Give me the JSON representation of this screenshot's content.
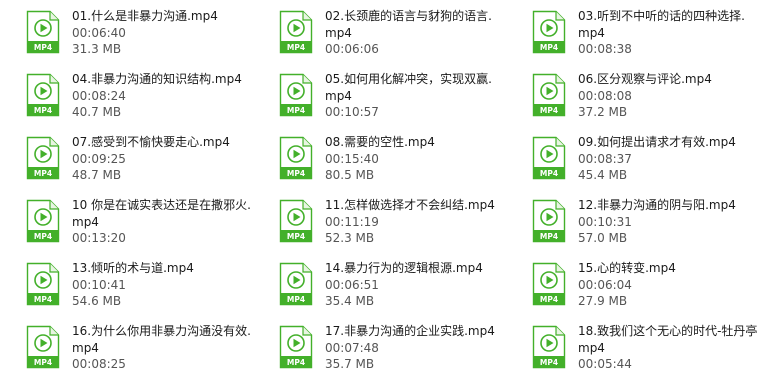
{
  "icon": {
    "label": "MP4",
    "name": "mp4-file-icon",
    "accent": "#43b02a"
  },
  "files": [
    {
      "lines": [
        "01.什么是非暴力沟通.mp4",
        "00:06:40",
        "31.3 MB"
      ]
    },
    {
      "lines": [
        "02.长颈鹿的语言与豺狗的语言.",
        "mp4",
        "00:06:06"
      ]
    },
    {
      "lines": [
        "03.听到不中听的话的四种选择.",
        "mp4",
        "00:08:38"
      ]
    },
    {
      "lines": [
        "04.非暴力沟通的知识结构.mp4",
        "00:08:24",
        "40.7 MB"
      ]
    },
    {
      "lines": [
        "05.如何用化解冲突，实现双赢.",
        "mp4",
        "00:10:57"
      ]
    },
    {
      "lines": [
        "06.区分观察与评论.mp4",
        "00:08:08",
        "37.2 MB"
      ]
    },
    {
      "lines": [
        "07.感受到不愉快要走心.mp4",
        "00:09:25",
        "48.7 MB"
      ]
    },
    {
      "lines": [
        "08.需要的空性.mp4",
        "00:15:40",
        "80.5 MB"
      ]
    },
    {
      "lines": [
        "09.如何提出请求才有效.mp4",
        "00:08:37",
        "45.4 MB"
      ]
    },
    {
      "lines": [
        "10 你是在诚实表达还是在撒邪火.",
        "mp4",
        "00:13:20"
      ]
    },
    {
      "lines": [
        "11.怎样做选择才不会纠结.mp4",
        "00:11:19",
        "52.3 MB"
      ]
    },
    {
      "lines": [
        "12.非暴力沟通的阴与阳.mp4",
        "00:10:31",
        "57.0 MB"
      ]
    },
    {
      "lines": [
        "13.倾听的术与道.mp4",
        "00:10:41",
        "54.6 MB"
      ]
    },
    {
      "lines": [
        "14.暴力行为的逻辑根源.mp4",
        "00:06:51",
        "35.4 MB"
      ]
    },
    {
      "lines": [
        "15.心的转变.mp4",
        "00:06:04",
        "27.9 MB"
      ]
    },
    {
      "lines": [
        "16.为什么你用非暴力沟通没有效.",
        "mp4",
        "00:08:25"
      ]
    },
    {
      "lines": [
        "17.非暴力沟通的企业实践.mp4",
        "00:07:48",
        "35.7 MB"
      ]
    },
    {
      "lines": [
        "18.致我们这个无心的时代-牡丹亭.",
        "mp4",
        "00:05:44"
      ]
    }
  ]
}
